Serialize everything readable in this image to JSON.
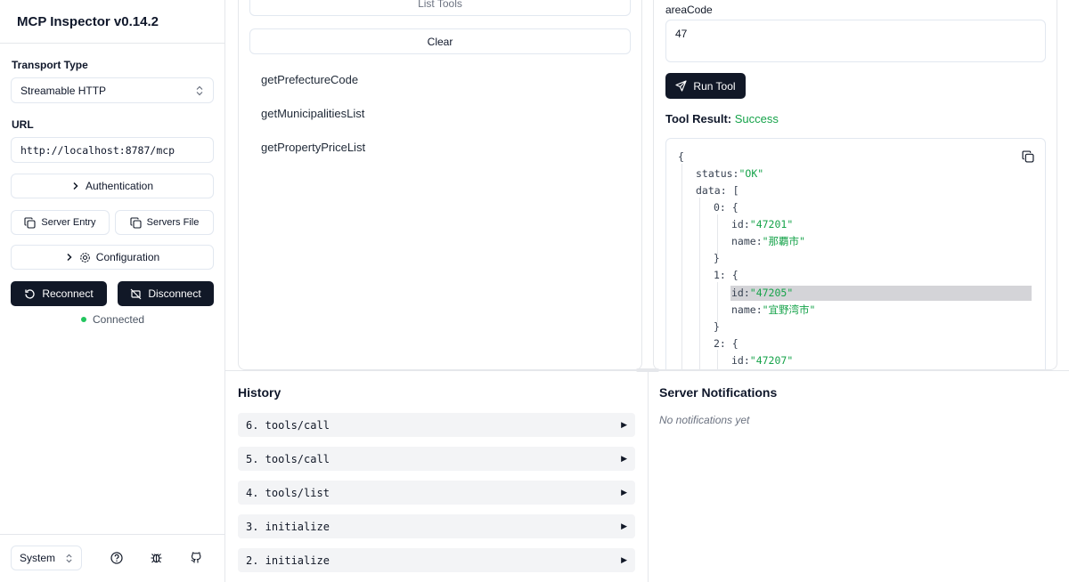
{
  "app": {
    "title": "MCP Inspector v0.14.2"
  },
  "sidebar": {
    "transport_label": "Transport Type",
    "transport_value": "Streamable HTTP",
    "url_label": "URL",
    "url_value": "http://localhost:8787/mcp",
    "authentication_label": "Authentication",
    "server_entry_label": "Server Entry",
    "servers_file_label": "Servers File",
    "configuration_label": "Configuration",
    "reconnect_label": "Reconnect",
    "disconnect_label": "Disconnect",
    "status_text": "Connected",
    "status_color": "#22c55e",
    "theme_value": "System"
  },
  "tools": {
    "list_tools_label": "List Tools",
    "clear_label": "Clear",
    "items": [
      "getPrefectureCode",
      "getMunicipalitiesList",
      "getPropertyPriceList"
    ]
  },
  "detail": {
    "param_label": "areaCode",
    "param_value": "47",
    "run_label": "Run Tool",
    "result_label": "Tool Result:",
    "result_status": "Success",
    "json": {
      "open_brace": "{",
      "status_key": "status:",
      "status_val": "\"OK\"",
      "data_key": "data:",
      "data_open": "[",
      "item0_key": "0:",
      "item0_open": "{",
      "item0_id_key": "id:",
      "item0_id_val": "\"47201\"",
      "item0_name_key": "name:",
      "item0_name_val": "\"那覇市\"",
      "item0_close": "}",
      "item1_key": "1:",
      "item1_open": "{",
      "item1_id_key": "id:",
      "item1_id_val": "\"47205\"",
      "item1_name_key": "name:",
      "item1_name_val": "\"宜野湾市\"",
      "item1_close": "}",
      "item2_key": "2:",
      "item2_open": "{",
      "item2_id_key": "id:",
      "item2_id_val": "\"47207\""
    }
  },
  "history": {
    "title": "History",
    "items": [
      "6. tools/call",
      "5. tools/call",
      "4. tools/list",
      "3. initialize",
      "2. initialize"
    ],
    "arrow": "▶"
  },
  "notifications": {
    "title": "Server Notifications",
    "empty": "No notifications yet"
  }
}
